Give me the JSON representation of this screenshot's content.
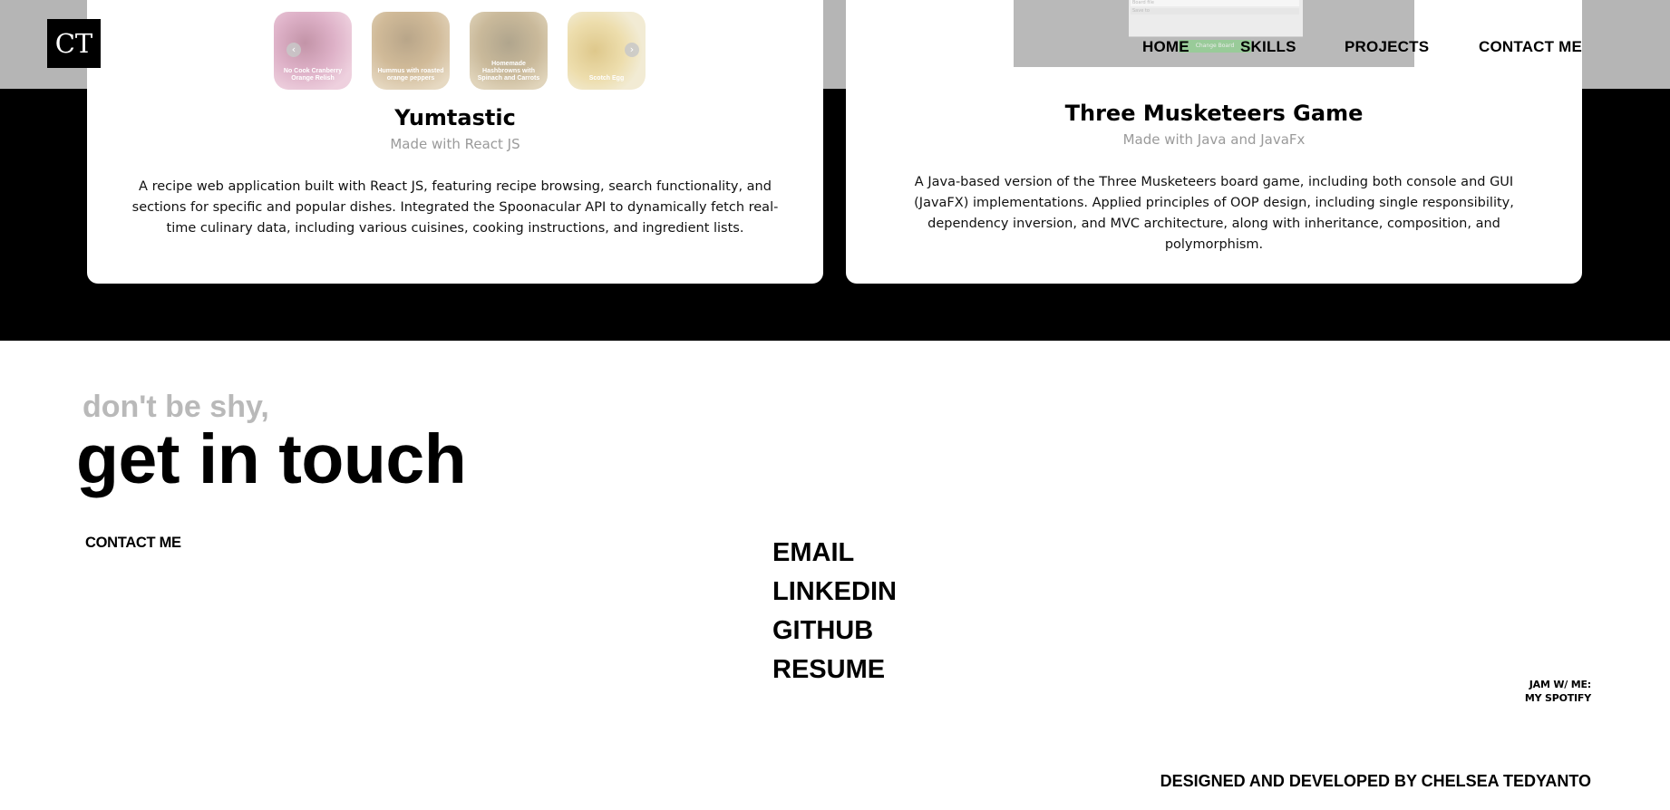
{
  "header": {
    "logo": "CT",
    "nav": [
      "HOME",
      "SKILLS",
      "PROJECTS",
      "CONTACT ME"
    ]
  },
  "projects": [
    {
      "title": "Yumtastic",
      "subtitle": "Made with React JS",
      "description": "A recipe web application built with React JS, featuring recipe browsing, search functionality, and sections for specific and popular dishes. Integrated the Spoonacular API to dynamically fetch real-time culinary data, including various cuisines, cooking instructions, and ingredient lists.",
      "carousel": {
        "slides": [
          "No Cook Cranberry Orange Relish",
          "Hummus with roasted orange peppers",
          "Homemade Hashbrowns with Spinach and Carrots",
          "Scotch Egg"
        ],
        "prev_icon": "chevron-left-icon",
        "next_icon": "chevron-right-icon"
      }
    },
    {
      "title": "Three Musketeers Game",
      "subtitle": "Made with Java and JavaFx",
      "description": "A Java-based version of the Three Musketeers board game, including both console and GUI (JavaFX) implementations. Applied principles of OOP design, including single responsibility, dependency inversion, and MVC architecture, along with inheritance, composition, and polymorphism.",
      "preview": {
        "field_1": "Board file",
        "field_2": "Save to",
        "button": "Change Board"
      }
    }
  ],
  "contact": {
    "eyebrow": "don't be shy,",
    "heading": "get in touch",
    "section_label": "CONTACT ME",
    "links": [
      "EMAIL",
      "LINKEDIN",
      "GITHUB",
      "RESUME"
    ]
  },
  "spotify": {
    "line_1": "JAM W/ ME:",
    "line_2": "MY SPOTIFY"
  },
  "footer": {
    "credit": "DESIGNED AND DEVELOPED BY CHELSEA TEDYANTO"
  },
  "colors": {
    "background": "#ffffff",
    "dark_band": "#000000",
    "header_strip": "#b5b5b5",
    "muted_text": "#9a9a9a",
    "eyebrow_text": "#b9b9b9",
    "preview_button": "#8fd18f"
  }
}
